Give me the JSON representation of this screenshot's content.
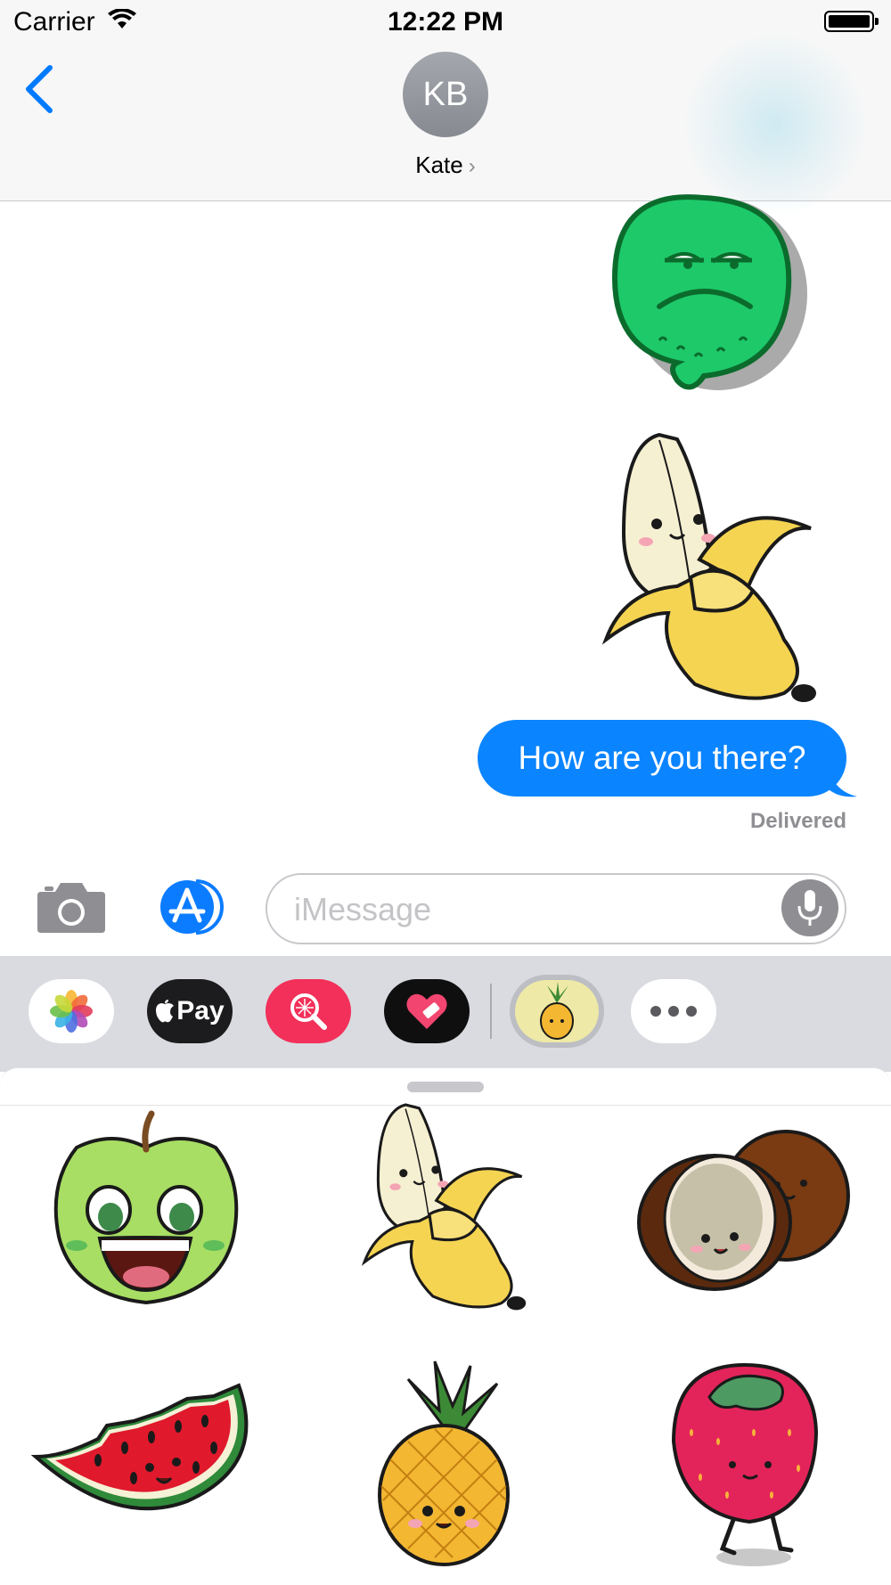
{
  "status_bar": {
    "carrier": "Carrier",
    "time": "12:22 PM"
  },
  "header": {
    "avatar_initials": "KB",
    "contact_name": "Kate"
  },
  "conversation": {
    "stickers": [
      "lime-sticker",
      "banana-sticker"
    ],
    "message": "How are you there?",
    "status": "Delivered"
  },
  "input": {
    "placeholder": "iMessage"
  },
  "app_drawer": {
    "apps": [
      "photos",
      "apple-pay",
      "search",
      "heart",
      "pineapple-stickers",
      "more"
    ],
    "apple_pay_label": "Pay"
  },
  "sticker_panel": {
    "stickers": [
      "apple",
      "banana",
      "coconut",
      "watermelon",
      "pineapple",
      "strawberry"
    ]
  },
  "colors": {
    "bubble": "#0b84ff",
    "ios_blue": "#007aff",
    "search_app": "#f2305a"
  }
}
